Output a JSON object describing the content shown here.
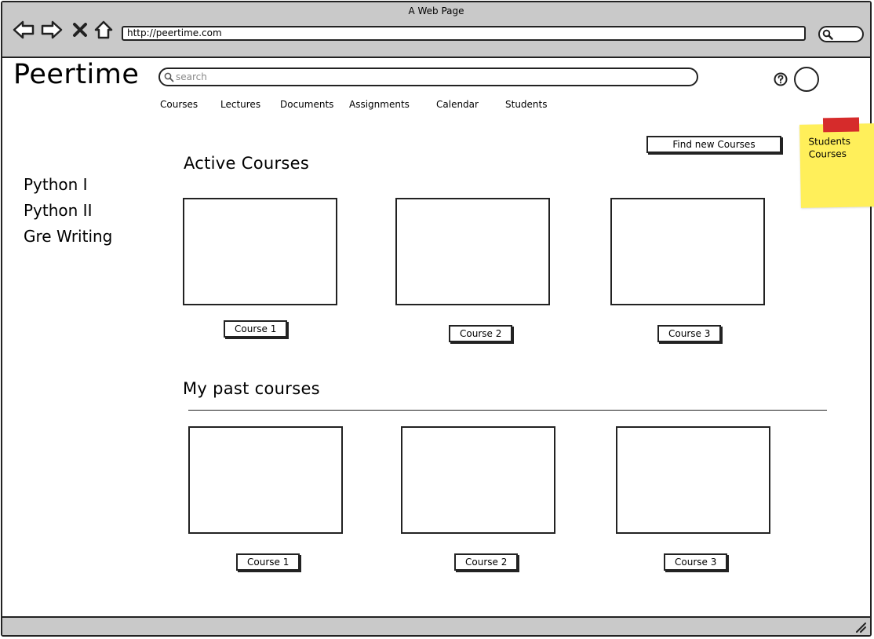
{
  "browser": {
    "window_title": "A Web Page",
    "url": "http://peertime.com"
  },
  "header": {
    "logo": "Peertime",
    "search_placeholder": "search"
  },
  "nav": [
    {
      "label": "Courses"
    },
    {
      "label": "Lectures"
    },
    {
      "label": "Documents"
    },
    {
      "label": "Assignments"
    },
    {
      "label": "Calendar"
    },
    {
      "label": "Students"
    }
  ],
  "sidebar": {
    "items": [
      {
        "label": "Python I"
      },
      {
        "label": "Python II"
      },
      {
        "label": "Gre Writing"
      }
    ]
  },
  "main": {
    "find_button": "Find new Courses",
    "active_title": "Active Courses",
    "active_courses": [
      {
        "label": "Course 1"
      },
      {
        "label": "Course 2"
      },
      {
        "label": "Course 3"
      }
    ],
    "past_title": "My past courses",
    "past_courses": [
      {
        "label": "Course 1"
      },
      {
        "label": "Course 2"
      },
      {
        "label": "Course 3"
      }
    ]
  },
  "sticky_note": {
    "line1": "Students",
    "line2": "Courses"
  },
  "colors": {
    "chrome": "#c9c9c9",
    "sticky": "#ffef5a",
    "tape": "#d62b2b"
  }
}
